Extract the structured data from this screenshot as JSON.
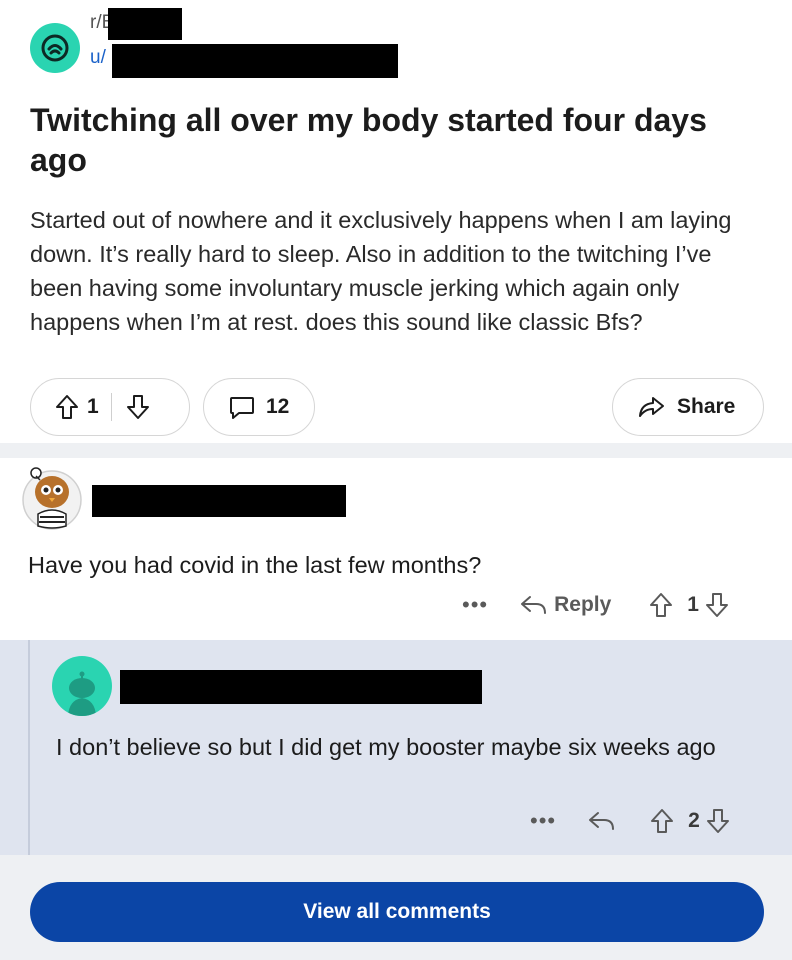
{
  "post": {
    "subreddit_prefix": "r/B",
    "user_prefix": "u/",
    "title": "Twitching all over my body started four days ago",
    "body": "Started out of nowhere and it exclusively happens when I am laying down. It’s really hard to sleep. Also in addition to the twitching I’ve been having some involuntary muscle jerking which again only happens when I’m at rest. does this sound like classic Bfs?",
    "upvotes": "1",
    "comments": "12",
    "share_label": "Share"
  },
  "comment": {
    "text": "Have you had covid in the last few months?",
    "more": "•••",
    "reply_label": "Reply",
    "votes": "1"
  },
  "reply": {
    "text": "I don’t believe so but I did get my booster maybe six weeks ago",
    "more": "•••",
    "votes": "2"
  },
  "footer": {
    "view_all_label": "View all comments"
  },
  "colors": {
    "accent": "#0b45a6",
    "teal": "#2ad4b1",
    "link": "#1b62c9",
    "reply_bg": "#dfe4ef"
  }
}
